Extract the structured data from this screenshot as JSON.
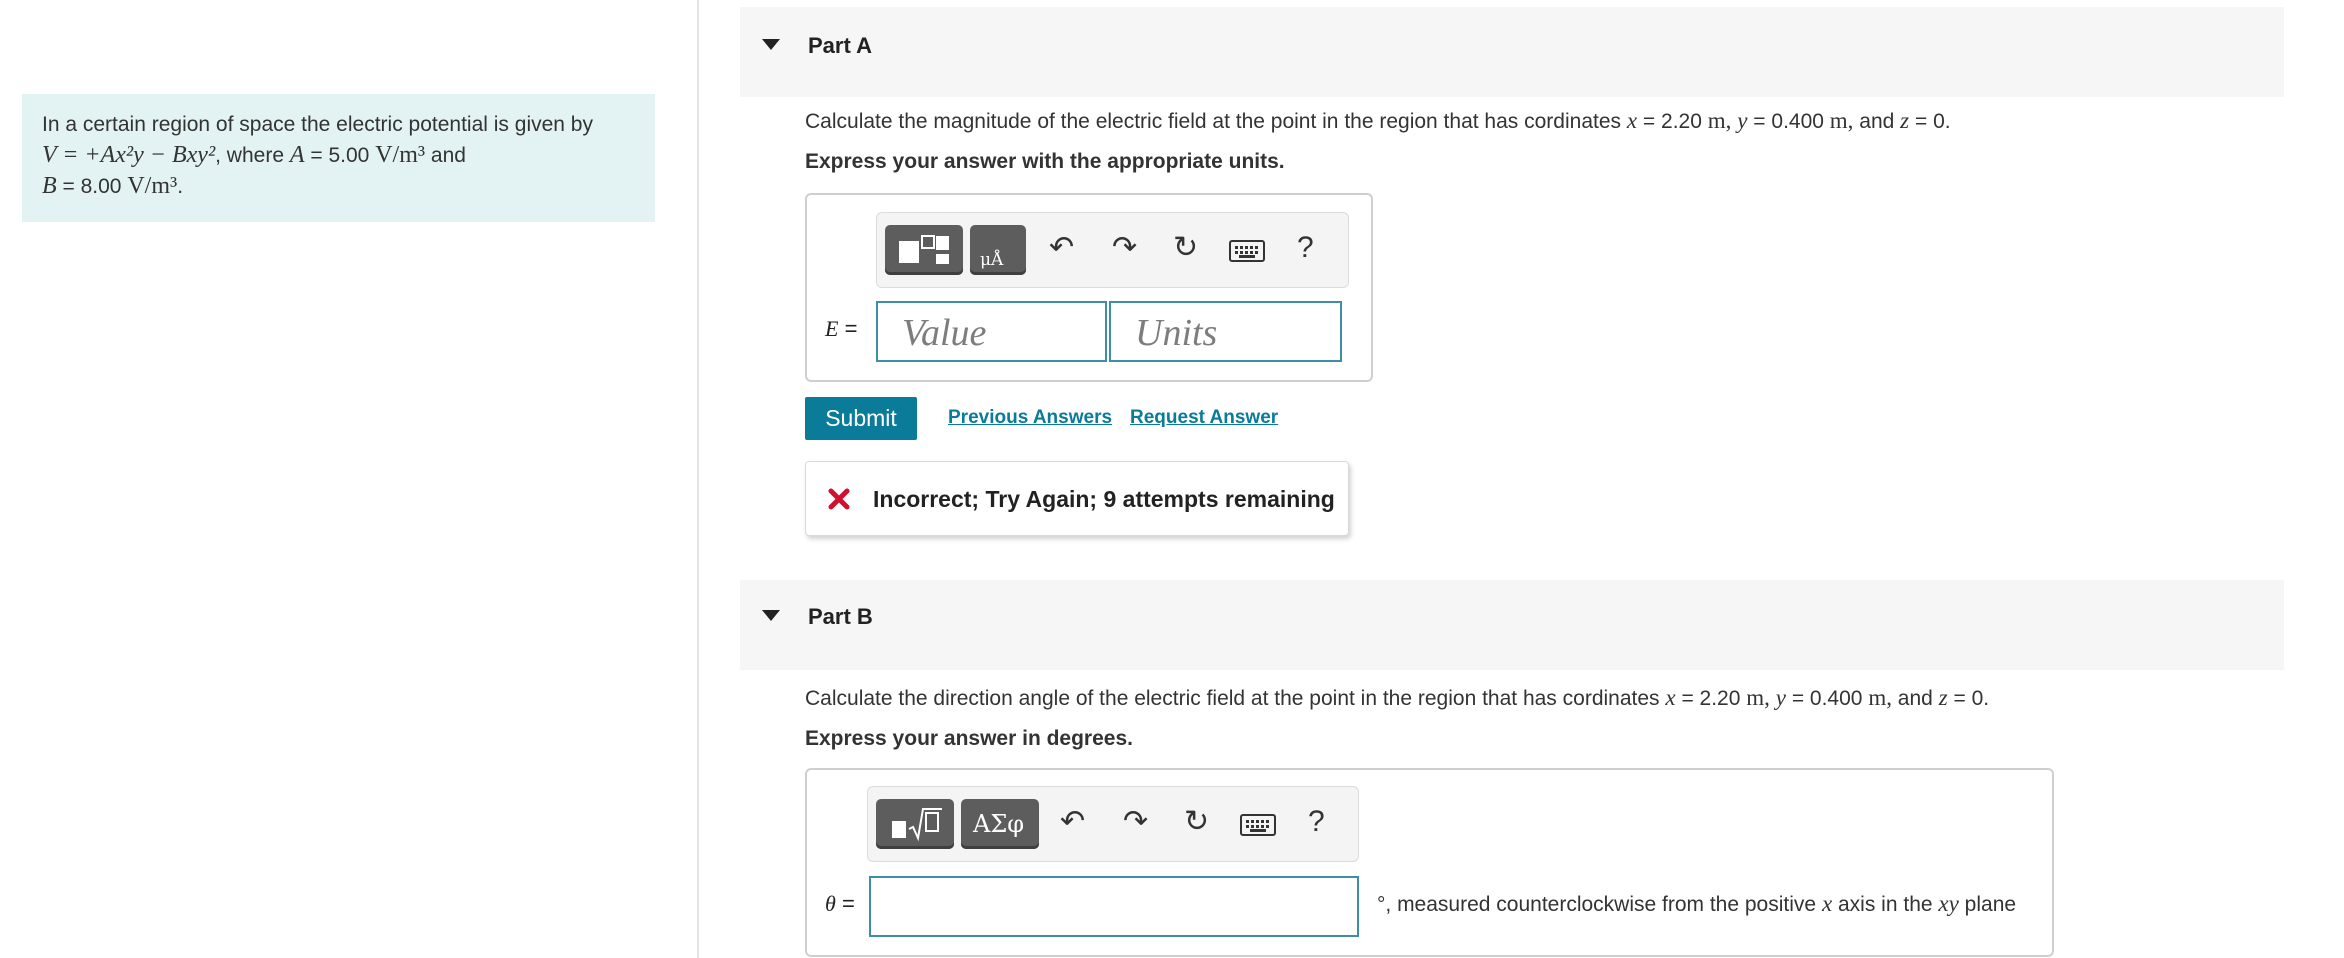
{
  "problem": {
    "intro_text": "In a certain region of space the electric potential is given by",
    "equation": "V = +Ax²y − Bxy²",
    "where_text": ", where",
    "A_symbol": "A",
    "A_value": "= 5.00",
    "A_unit": "V/m³",
    "and_text": "and",
    "B_symbol": "B",
    "B_value": "= 8.00",
    "B_unit": "V/m³",
    "period": "."
  },
  "part_a": {
    "title": "Part A",
    "question_prefix": "Calculate the magnitude of the electric field at the point in the region that has cordinates",
    "x_var": "x",
    "x_val": "= 2.20",
    "x_unit": "m,",
    "y_var": "y",
    "y_val": "= 0.400",
    "y_unit": "m,",
    "and_text": "and",
    "z_var": "z",
    "z_val": "= 0.",
    "instruction": "Express your answer with the appropriate units.",
    "answer_label_var": "E",
    "answer_label_eq": "=",
    "value_placeholder": "Value",
    "units_placeholder": "Units",
    "help_label": "?",
    "submit_label": "Submit",
    "previous_answers_label": "Previous Answers",
    "request_answer_label": "Request Answer",
    "feedback_text": "Incorrect; Try Again; 9 attempts remaining"
  },
  "part_b": {
    "title": "Part B",
    "question_prefix": "Calculate the direction angle of the electric field at the point in the region that has cordinates",
    "x_var": "x",
    "x_val": "= 2.20",
    "x_unit": "m,",
    "y_var": "y",
    "y_val": "= 0.400",
    "y_unit": "m,",
    "and_text": "and",
    "z_var": "z",
    "z_val": "= 0.",
    "instruction": "Express your answer in degrees.",
    "answer_label_var": "θ",
    "answer_label_eq": "=",
    "greek_button_label": "ΑΣφ",
    "help_label": "?",
    "suffix_degree": "°, measured counterclockwise from the positive",
    "suffix_axis_var": "x",
    "suffix_axis_text": "axis in the",
    "suffix_plane_var": "xy",
    "suffix_plane_text": "plane"
  },
  "icons": [
    "caret-down-icon",
    "templates-icon",
    "units-icon",
    "undo-icon",
    "redo-icon",
    "reset-icon",
    "keyboard-icon",
    "help-icon",
    "sqrt-template-icon",
    "incorrect-x-icon"
  ],
  "colors": {
    "accent": "#0a7b98",
    "intro_bg": "#e3f3f4",
    "error": "#d0102f",
    "input_border": "#3e8ea5"
  }
}
